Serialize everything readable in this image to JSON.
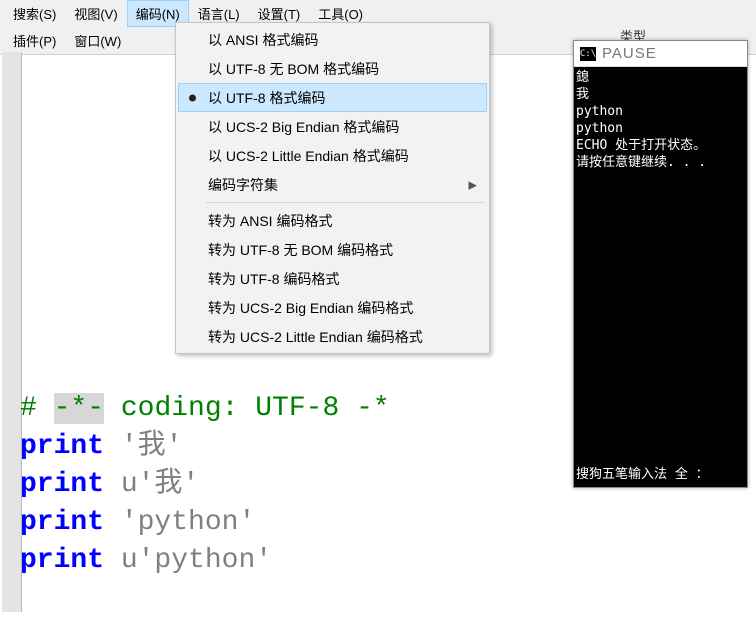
{
  "menubar": {
    "row1": [
      "搜索(S)",
      "视图(V)",
      "编码(N)",
      "语言(L)",
      "设置(T)",
      "工具(O)"
    ],
    "row2": [
      "插件(P)",
      "窗口(W)"
    ]
  },
  "active_menu_index": 2,
  "dropdown": {
    "items": [
      {
        "label": "以 ANSI 格式编码"
      },
      {
        "label": "以 UTF-8 无 BOM 格式编码"
      },
      {
        "label": "以 UTF-8 格式编码",
        "checked": true,
        "selected": true
      },
      {
        "label": "以 UCS-2 Big Endian 格式编码"
      },
      {
        "label": "以 UCS-2 Little Endian 格式编码"
      },
      {
        "label": "编码字符集",
        "submenu": true
      }
    ],
    "items2": [
      {
        "label": "转为 ANSI 编码格式"
      },
      {
        "label": "转为 UTF-8 无 BOM 编码格式"
      },
      {
        "label": "转为 UTF-8 编码格式"
      },
      {
        "label": "转为 UCS-2 Big Endian 编码格式"
      },
      {
        "label": "转为 UCS-2 Little Endian 编码格式"
      }
    ]
  },
  "code": {
    "line1_comment_a": "# ",
    "line1_comment_b": "-*-",
    "line1_comment_c": " coding: UTF-8 -*",
    "kw": "print",
    "s1": " '我'",
    "s2": " u'我'",
    "s3": " 'python'",
    "s4": " u'python'"
  },
  "terminal": {
    "title": "PAUSE",
    "icon_text": "C:\\",
    "lines": [
      "鎴",
      "我",
      "python",
      "python",
      "ECHO 处于打开状态。",
      "请按任意键继续. . ."
    ],
    "status": "搜狗五笔输入法 全 ："
  },
  "cut_label": "类型"
}
